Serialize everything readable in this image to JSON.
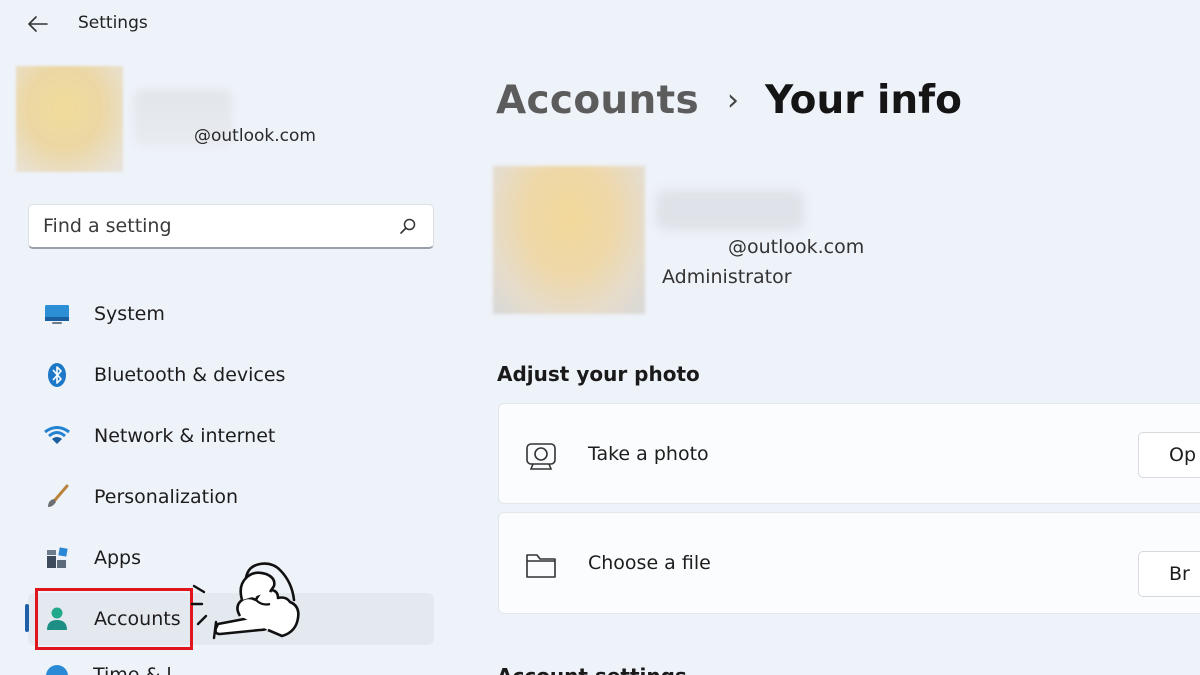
{
  "window": {
    "title": "Settings"
  },
  "sidebar": {
    "profile": {
      "email": "@outlook.com"
    },
    "search": {
      "placeholder": "Find a setting"
    },
    "items": [
      {
        "label": "System",
        "icon": "monitor-icon"
      },
      {
        "label": "Bluetooth & devices",
        "icon": "bluetooth-icon"
      },
      {
        "label": "Network & internet",
        "icon": "wifi-icon"
      },
      {
        "label": "Personalization",
        "icon": "brush-icon"
      },
      {
        "label": "Apps",
        "icon": "apps-icon"
      },
      {
        "label": "Accounts",
        "icon": "person-icon",
        "selected": true
      },
      {
        "label": "Time & l",
        "icon": "globe-clock-icon"
      }
    ]
  },
  "main": {
    "breadcrumb": {
      "parent": "Accounts",
      "separator": "›",
      "current": "Your info"
    },
    "user": {
      "email": "@outlook.com",
      "role": "Administrator"
    },
    "adjust_photo": {
      "title": "Adjust your photo",
      "options": [
        {
          "label": "Take a photo",
          "button": "Op",
          "icon": "camera-icon"
        },
        {
          "label": "Choose a file",
          "button": "Br",
          "icon": "folder-icon"
        }
      ]
    },
    "next_section_title_partial": "Account settings"
  },
  "colors": {
    "accent": "#1f5fa8",
    "highlight_border": "#e0161c",
    "background": "#eef2f9",
    "card": "#fbfcfd"
  }
}
